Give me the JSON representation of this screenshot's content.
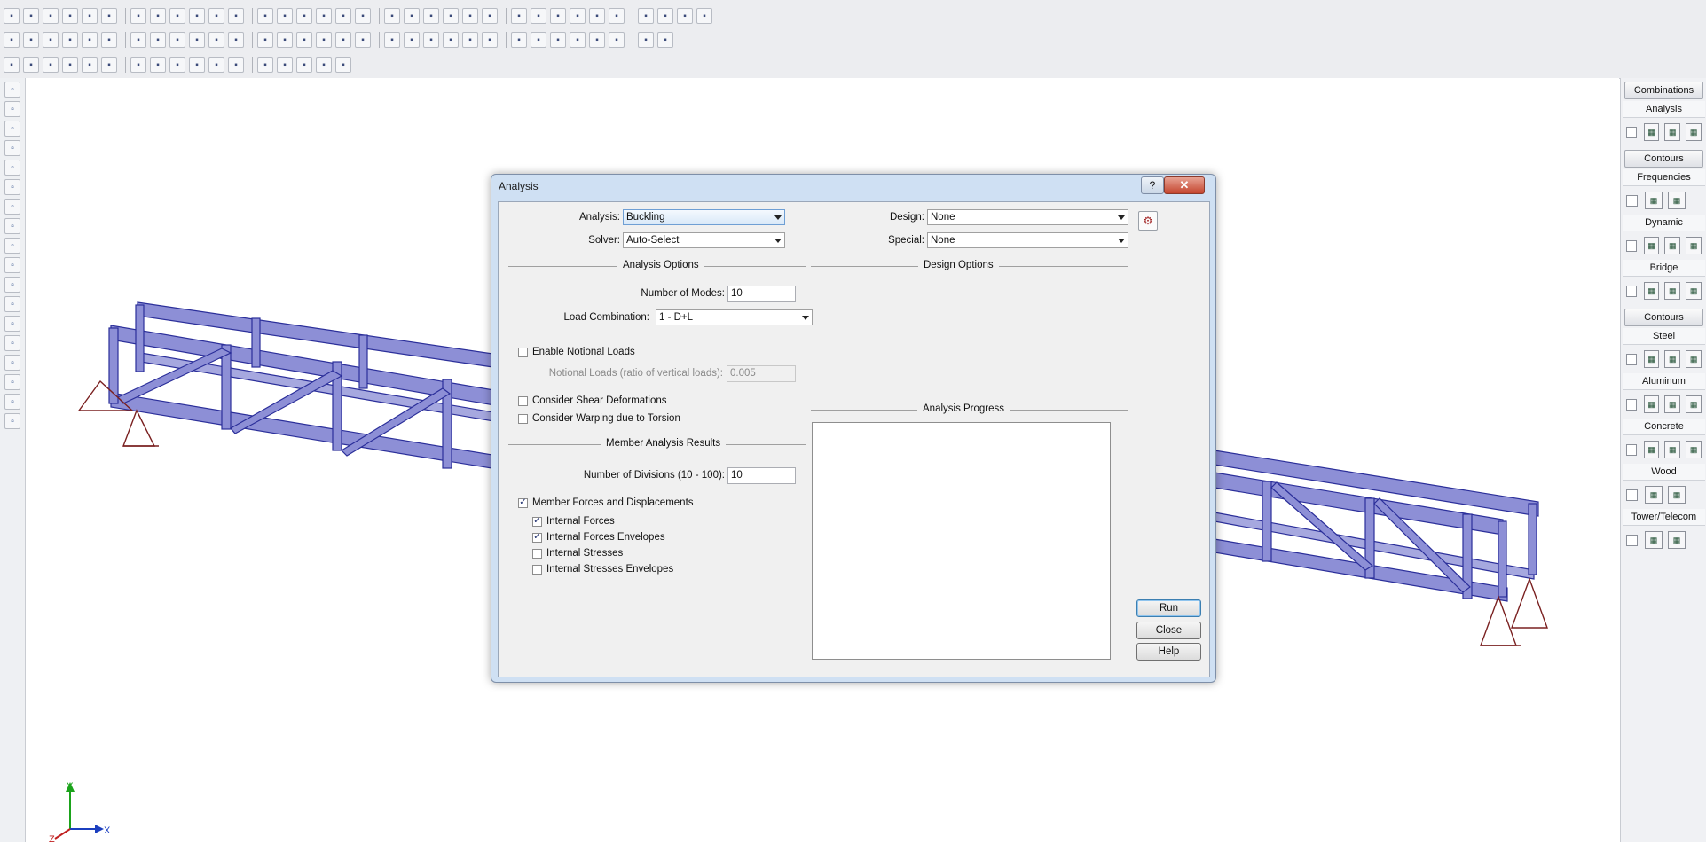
{
  "toolbars": {
    "row1_icons": [
      "new-file",
      "open",
      "save",
      "print",
      "undo",
      "redo",
      "edit",
      "2d-3d-toggle",
      "render",
      "member",
      "window",
      "select-box",
      "select-line",
      "select-unselect",
      "graphic",
      "list",
      "grid",
      "wall",
      "plate",
      "solid",
      "hinge",
      "box",
      "column",
      "brick",
      "beam",
      "spring",
      "frame",
      "load",
      "spreadsheet",
      "filter",
      "lock",
      "eraser",
      "color",
      "find"
    ],
    "row2_icons": [
      "table",
      "node",
      "member-draw",
      "support",
      "plate-draw",
      "solid-draw",
      "delete-node",
      "delete-member",
      "delete-support",
      "delete-plate",
      "delete-solid",
      "delete-all",
      "modify",
      "renumber",
      "merge",
      "split",
      "rotate",
      "mirror",
      "scale",
      "copy",
      "move",
      "contours",
      "boundary",
      "measure",
      "color-wheel",
      "pencil",
      "dropdown",
      "hinge-tool",
      "release",
      "offset",
      "area-load",
      "dropdown2"
    ],
    "row3_icons": [
      "select-node",
      "select-member",
      "select-plate",
      "select-solid",
      "window-select",
      "box-select",
      "polygon-select",
      "lasso-select",
      "invert-select",
      "select-all",
      "criteria-select",
      "unselect-all",
      "lock-selection",
      "zoom-select",
      "zoom-unselect",
      "fence",
      "checkmark"
    ]
  },
  "left_tools": [
    "pan-hand",
    "globe-rotate",
    "snap-grid",
    "orbit",
    "zoom-window",
    "zoom-out",
    "view-iso",
    "view-front",
    "view-top",
    "view-side",
    "view-3d",
    "view-render",
    "view-plan",
    "view-elevation",
    "fit-model",
    "delete-layer",
    "visibility",
    "layer-tools"
  ],
  "right_panel": {
    "combinations_label": "Combinations",
    "sections": [
      {
        "title": "Analysis",
        "icons": 3
      },
      {
        "button": "Contours"
      },
      {
        "title": "Frequencies",
        "icons": 2
      },
      {
        "title": "Dynamic",
        "icons": 3
      },
      {
        "title": "Bridge",
        "icons": 3
      },
      {
        "button": "Contours"
      },
      {
        "title": "Steel",
        "icons": 3
      },
      {
        "title": "Aluminum",
        "icons": 3
      },
      {
        "title": "Concrete",
        "icons": 3
      },
      {
        "title": "Wood",
        "icons": 2
      },
      {
        "title": "Tower/Telecom",
        "icons": 2
      }
    ]
  },
  "dialog": {
    "title": "Analysis",
    "help_label": "?",
    "close_label": "✕",
    "analysis_label": "Analysis:",
    "analysis_value": "Buckling",
    "solver_label": "Solver:",
    "solver_value": "Auto-Select",
    "design_label": "Design:",
    "design_value": "None",
    "special_label": "Special:",
    "special_value": "None",
    "analysis_options_title": "Analysis Options",
    "design_options_title": "Design Options",
    "num_modes_label": "Number of Modes:",
    "num_modes_value": "10",
    "load_combination_label": "Load Combination:",
    "load_combination_value": "1 - D+L",
    "enable_notional_loads": "Enable Notional Loads",
    "notional_loads_label": "Notional Loads (ratio of vertical loads):",
    "notional_loads_value": "0.005",
    "consider_shear": "Consider Shear Deformations",
    "consider_warping": "Consider Warping due to Torsion",
    "analysis_progress_title": "Analysis Progress",
    "member_results_title": "Member Analysis Results",
    "num_divisions_label": "Number of Divisions (10 - 100):",
    "num_divisions_value": "10",
    "member_forces": "Member Forces and Displacements",
    "internal_forces": "Internal Forces",
    "internal_forces_env": "Internal Forces Envelopes",
    "internal_stresses": "Internal Stresses",
    "internal_stresses_env": "Internal Stresses Envelopes",
    "run_label": "Run",
    "close_btn_label": "Close",
    "help_btn_label": "Help",
    "checks": {
      "enable_notional_loads": false,
      "consider_shear": false,
      "consider_warping": false,
      "member_forces": true,
      "internal_forces": true,
      "internal_forces_env": true,
      "internal_stresses": false,
      "internal_stresses_env": false
    }
  },
  "axis_triad": {
    "x": "X",
    "y": "Y",
    "z": "Z"
  },
  "colors": {
    "truss": "#8d8fd6",
    "truss_edge": "#2b2f9a",
    "support": "#7a2020",
    "axis_x": "#1b3fbf",
    "axis_y": "#1ba31b",
    "axis_z": "#c01f1f"
  }
}
